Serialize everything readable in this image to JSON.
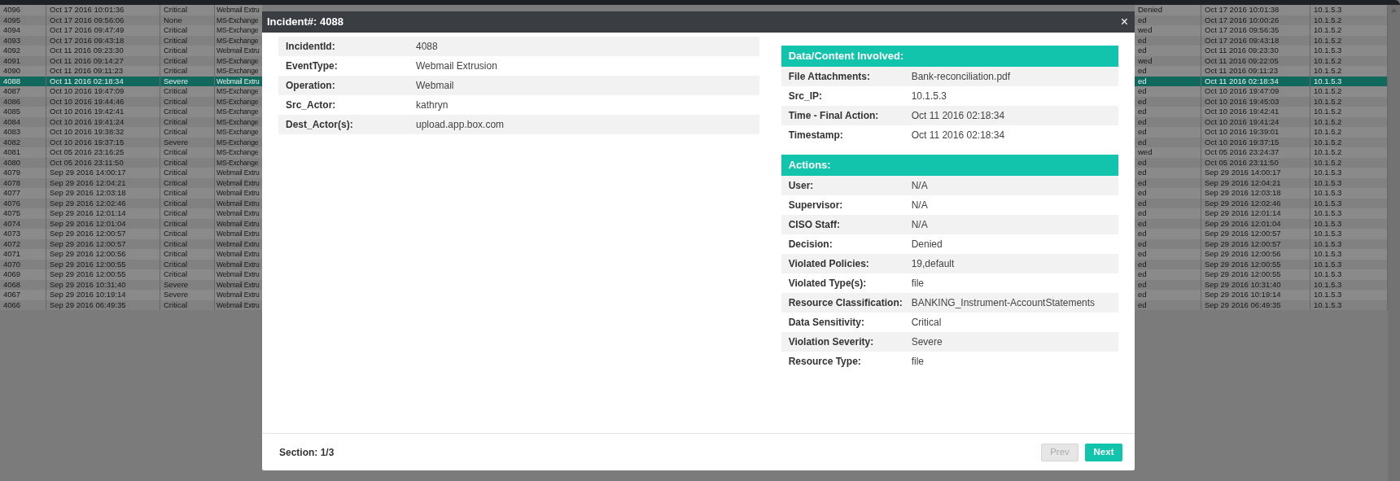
{
  "table": {
    "rows": [
      {
        "id": "4096",
        "time": "Oct 17 2016 10:01:36",
        "severity": "Critical",
        "event_type": "Webmail Extru",
        "decision": "Denied",
        "final_time": "Oct 17 2016 10:01:38",
        "src_ip": "10.1.5.3",
        "selected": false
      },
      {
        "id": "4095",
        "time": "Oct 17 2016 09:56:06",
        "severity": "None",
        "event_type": "MS-Exchange",
        "decision": "ed",
        "final_time": "Oct 17 2016 10:00:26",
        "src_ip": "10.1.5.2",
        "selected": false
      },
      {
        "id": "4094",
        "time": "Oct 17 2016 09:47:49",
        "severity": "Critical",
        "event_type": "MS-Exchange",
        "decision": "wed",
        "final_time": "Oct 17 2016 09:56:35",
        "src_ip": "10.1.5.2",
        "selected": false
      },
      {
        "id": "4093",
        "time": "Oct 17 2016 09:43:18",
        "severity": "Critical",
        "event_type": "MS-Exchange",
        "decision": "ed",
        "final_time": "Oct 17 2016 09:43:18",
        "src_ip": "10.1.5.2",
        "selected": false
      },
      {
        "id": "4092",
        "time": "Oct 11 2016 09:23:30",
        "severity": "Critical",
        "event_type": "Webmail Extru",
        "decision": "ed",
        "final_time": "Oct 11 2016 09:23:30",
        "src_ip": "10.1.5.3",
        "selected": false
      },
      {
        "id": "4091",
        "time": "Oct 11 2016 09:14:27",
        "severity": "Critical",
        "event_type": "MS-Exchange",
        "decision": "wed",
        "final_time": "Oct 11 2016 09:22:05",
        "src_ip": "10.1.5.2",
        "selected": false
      },
      {
        "id": "4090",
        "time": "Oct 11 2016 09:11:23",
        "severity": "Critical",
        "event_type": "MS-Exchange",
        "decision": "ed",
        "final_time": "Oct 11 2016 09:11:23",
        "src_ip": "10.1.5.2",
        "selected": false
      },
      {
        "id": "4088",
        "time": "Oct 11 2016 02:18:34",
        "severity": "Severe",
        "event_type": "Webmail Extru",
        "decision": "ed",
        "final_time": "Oct 11 2016 02:18:34",
        "src_ip": "10.1.5.3",
        "selected": true
      },
      {
        "id": "4087",
        "time": "Oct 10 2016 19:47:09",
        "severity": "Critical",
        "event_type": "MS-Exchange",
        "decision": "ed",
        "final_time": "Oct 10 2016 19:47:09",
        "src_ip": "10.1.5.2",
        "selected": false
      },
      {
        "id": "4086",
        "time": "Oct 10 2016 19:44:46",
        "severity": "Critical",
        "event_type": "MS-Exchange",
        "decision": "ed",
        "final_time": "Oct 10 2016 19:45:03",
        "src_ip": "10.1.5.2",
        "selected": false
      },
      {
        "id": "4085",
        "time": "Oct 10 2016 19:42:41",
        "severity": "Critical",
        "event_type": "MS-Exchange",
        "decision": "ed",
        "final_time": "Oct 10 2016 19:42:41",
        "src_ip": "10.1.5.2",
        "selected": false
      },
      {
        "id": "4084",
        "time": "Oct 10 2016 19:41:24",
        "severity": "Critical",
        "event_type": "MS-Exchange",
        "decision": "ed",
        "final_time": "Oct 10 2016 19:41:24",
        "src_ip": "10.1.5.2",
        "selected": false
      },
      {
        "id": "4083",
        "time": "Oct 10 2016 19:38:32",
        "severity": "Critical",
        "event_type": "MS-Exchange",
        "decision": "ed",
        "final_time": "Oct 10 2016 19:39:01",
        "src_ip": "10.1.5.2",
        "selected": false
      },
      {
        "id": "4082",
        "time": "Oct 10 2016 19:37:15",
        "severity": "Severe",
        "event_type": "MS-Exchange",
        "decision": "ed",
        "final_time": "Oct 10 2016 19:37:15",
        "src_ip": "10.1.5.2",
        "selected": false
      },
      {
        "id": "4081",
        "time": "Oct 05 2016 23:16:25",
        "severity": "Critical",
        "event_type": "MS-Exchange",
        "decision": "wed",
        "final_time": "Oct 05 2016 23:24:37",
        "src_ip": "10.1.5.2",
        "selected": false
      },
      {
        "id": "4080",
        "time": "Oct 05 2016 23:11:50",
        "severity": "Critical",
        "event_type": "MS-Exchange",
        "decision": "ed",
        "final_time": "Oct 05 2016 23:11:50",
        "src_ip": "10.1.5.2",
        "selected": false
      },
      {
        "id": "4079",
        "time": "Sep 29 2016 14:00:17",
        "severity": "Critical",
        "event_type": "Webmail Extru",
        "decision": "ed",
        "final_time": "Sep 29 2016 14:00:17",
        "src_ip": "10.1.5.3",
        "selected": false
      },
      {
        "id": "4078",
        "time": "Sep 29 2016 12:04:21",
        "severity": "Critical",
        "event_type": "Webmail Extru",
        "decision": "ed",
        "final_time": "Sep 29 2016 12:04:21",
        "src_ip": "10.1.5.3",
        "selected": false
      },
      {
        "id": "4077",
        "time": "Sep 29 2016 12:03:18",
        "severity": "Critical",
        "event_type": "Webmail Extru",
        "decision": "ed",
        "final_time": "Sep 29 2016 12:03:18",
        "src_ip": "10.1.5.3",
        "selected": false
      },
      {
        "id": "4076",
        "time": "Sep 29 2016 12:02:46",
        "severity": "Critical",
        "event_type": "Webmail Extru",
        "decision": "ed",
        "final_time": "Sep 29 2016 12:02:46",
        "src_ip": "10.1.5.3",
        "selected": false
      },
      {
        "id": "4075",
        "time": "Sep 29 2016 12:01:14",
        "severity": "Critical",
        "event_type": "Webmail Extru",
        "decision": "ed",
        "final_time": "Sep 29 2016 12:01:14",
        "src_ip": "10.1.5.3",
        "selected": false
      },
      {
        "id": "4074",
        "time": "Sep 29 2016 12:01:04",
        "severity": "Critical",
        "event_type": "Webmail Extru",
        "decision": "ed",
        "final_time": "Sep 29 2016 12:01:04",
        "src_ip": "10.1.5.3",
        "selected": false
      },
      {
        "id": "4073",
        "time": "Sep 29 2016 12:00:57",
        "severity": "Critical",
        "event_type": "Webmail Extru",
        "decision": "ed",
        "final_time": "Sep 29 2016 12:00:57",
        "src_ip": "10.1.5.3",
        "selected": false
      },
      {
        "id": "4072",
        "time": "Sep 29 2016 12:00:57",
        "severity": "Critical",
        "event_type": "Webmail Extru",
        "decision": "ed",
        "final_time": "Sep 29 2016 12:00:57",
        "src_ip": "10.1.5.3",
        "selected": false
      },
      {
        "id": "4071",
        "time": "Sep 29 2016 12:00:56",
        "severity": "Critical",
        "event_type": "Webmail Extru",
        "decision": "ed",
        "final_time": "Sep 29 2016 12:00:56",
        "src_ip": "10.1.5.3",
        "selected": false
      },
      {
        "id": "4070",
        "time": "Sep 29 2016 12:00:55",
        "severity": "Critical",
        "event_type": "Webmail Extru",
        "decision": "ed",
        "final_time": "Sep 29 2016 12:00:55",
        "src_ip": "10.1.5.3",
        "selected": false
      },
      {
        "id": "4069",
        "time": "Sep 29 2016 12:00:55",
        "severity": "Critical",
        "event_type": "Webmail Extru",
        "decision": "ed",
        "final_time": "Sep 29 2016 12:00:55",
        "src_ip": "10.1.5.3",
        "selected": false
      },
      {
        "id": "4068",
        "time": "Sep 29 2016 10:31:40",
        "severity": "Severe",
        "event_type": "Webmail Extru",
        "decision": "ed",
        "final_time": "Sep 29 2016 10:31:40",
        "src_ip": "10.1.5.3",
        "selected": false
      },
      {
        "id": "4067",
        "time": "Sep 29 2016 10:19:14",
        "severity": "Severe",
        "event_type": "Webmail Extru",
        "decision": "ed",
        "final_time": "Sep 29 2016 10:19:14",
        "src_ip": "10.1.5.3",
        "selected": false
      },
      {
        "id": "4066",
        "time": "Sep 29 2016 06:49:35",
        "severity": "Critical",
        "event_type": "Webmail Extru",
        "decision": "ed",
        "final_time": "Sep 29 2016 06:49:35",
        "src_ip": "10.1.5.3",
        "selected": false
      }
    ]
  },
  "dialog": {
    "title": "Incident#: 4088",
    "close": "×",
    "details": [
      {
        "label": "IncidentId:",
        "value": "4088"
      },
      {
        "label": "EventType:",
        "value": "Webmail Extrusion"
      },
      {
        "label": "Operation:",
        "value": "Webmail"
      },
      {
        "label": "Src_Actor:",
        "value": "kathryn"
      },
      {
        "label": "Dest_Actor(s):",
        "value": "upload.app.box.com"
      }
    ],
    "sections": [
      {
        "title": "Data/Content Involved:",
        "rows": [
          {
            "label": "File Attachments:",
            "value": "Bank-reconciliation.pdf"
          },
          {
            "label": "Src_IP:",
            "value": "10.1.5.3"
          },
          {
            "label": "Time - Final Action:",
            "value": "Oct 11 2016 02:18:34"
          },
          {
            "label": "Timestamp:",
            "value": "Oct 11 2016 02:18:34"
          }
        ]
      },
      {
        "title": "Actions:",
        "rows": [
          {
            "label": "User:",
            "value": "N/A"
          },
          {
            "label": "Supervisor:",
            "value": "N/A"
          },
          {
            "label": "CISO Staff:",
            "value": "N/A"
          },
          {
            "label": "Decision:",
            "value": "Denied"
          },
          {
            "label": "Violated Policies:",
            "value": "19,default"
          },
          {
            "label": "Violated Type(s):",
            "value": "file"
          },
          {
            "label": "Resource Classification:",
            "value": "BANKING_Instrument-AccountStatements"
          },
          {
            "label": "Data Sensitivity:",
            "value": "Critical"
          },
          {
            "label": "Violation Severity:",
            "value": "Severe"
          },
          {
            "label": "Resource Type:",
            "value": "file"
          }
        ]
      }
    ],
    "section_indicator": "Section: 1/3",
    "buttons": [
      {
        "label": "Prev",
        "disabled": true
      },
      {
        "label": "Next",
        "disabled": false
      }
    ]
  }
}
